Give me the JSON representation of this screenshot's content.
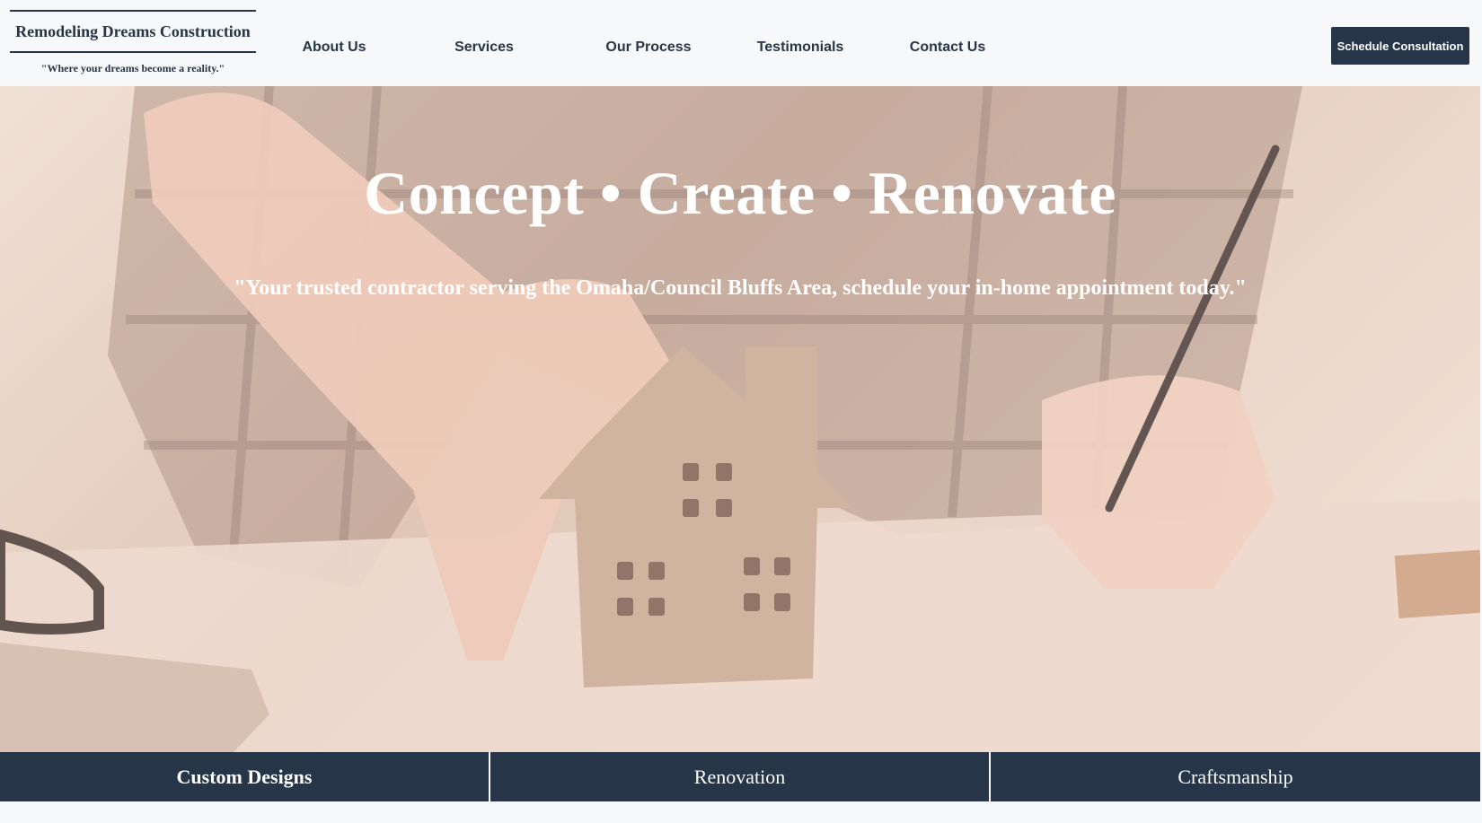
{
  "brand": {
    "name": "Remodeling Dreams Construction",
    "tagline": "\"Where your dreams become a reality.\""
  },
  "nav": {
    "items": [
      {
        "label": "About Us"
      },
      {
        "label": "Services"
      },
      {
        "label": "Our Process"
      },
      {
        "label": "Testimonials"
      },
      {
        "label": "Contact Us"
      }
    ]
  },
  "cta": {
    "label": "Schedule Consultation"
  },
  "hero": {
    "title": "Concept • Create • Renovate",
    "subtitle": "\"Your trusted contractor serving the Omaha/Council Bluffs Area, schedule your in-home appointment today.\""
  },
  "features": [
    {
      "label": "Custom Designs"
    },
    {
      "label": "Renovation"
    },
    {
      "label": "Craftsmanship"
    }
  ],
  "colors": {
    "navy": "#263548",
    "header_bg": "#f7f8f9",
    "hero_tint": "#d9c0b0"
  }
}
